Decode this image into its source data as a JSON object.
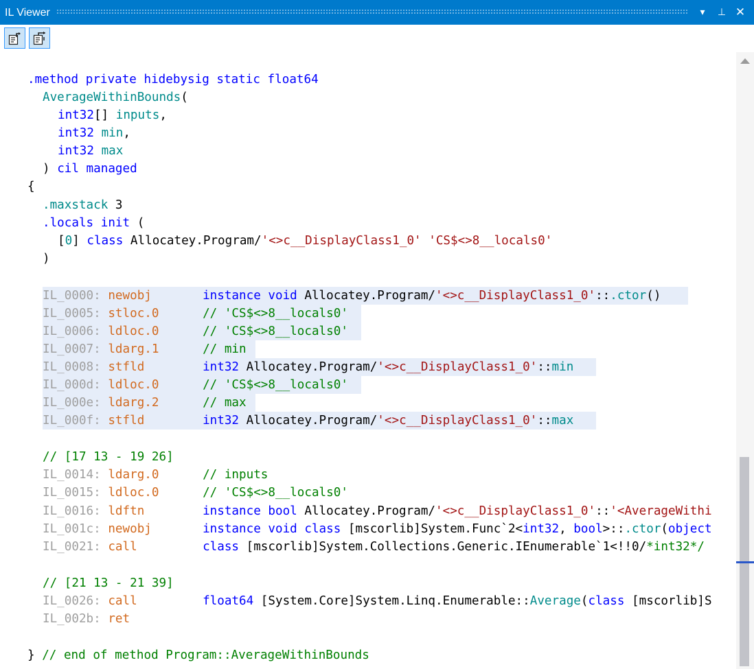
{
  "window": {
    "title": "IL Viewer",
    "dropdown_glyph": "▾",
    "pin_glyph": "⊥",
    "close_glyph": "✕"
  },
  "toolbar": {
    "buttons": [
      {
        "icon": "show-source-icon"
      },
      {
        "icon": "navigate-to-source-icon"
      }
    ]
  },
  "colors": {
    "accent": "#007acc",
    "keyword": "#0000ff",
    "label": "#a0a0a0",
    "opcode": "#d2691e",
    "string": "#a31515",
    "comment": "#008000",
    "member": "#008b8b",
    "highlight": "#e6edf9"
  },
  "code": {
    "lines": [
      [
        [
          "kw",
          ".method private hidebysig static float64"
        ]
      ],
      [
        [
          "mem",
          "AverageWithinBounds"
        ],
        [
          "tx",
          "("
        ]
      ],
      [
        [
          "kw",
          "int32"
        ],
        [
          "tx",
          "[] "
        ],
        [
          "mem",
          "inputs"
        ],
        [
          "tx",
          ","
        ]
      ],
      [
        [
          "kw",
          "int32"
        ],
        [
          "tx",
          " "
        ],
        [
          "mem",
          "min"
        ],
        [
          "tx",
          ","
        ]
      ],
      [
        [
          "kw",
          "int32"
        ],
        [
          "tx",
          " "
        ],
        [
          "mem",
          "max"
        ]
      ],
      [
        [
          "tx",
          ") "
        ],
        [
          "kw",
          "cil managed"
        ]
      ],
      [
        [
          "tx",
          "{"
        ]
      ],
      [
        [
          "mem",
          ".maxstack"
        ],
        [
          "tx",
          " 3"
        ]
      ],
      [
        [
          "kw",
          ".locals init"
        ],
        [
          "tx",
          " ("
        ]
      ],
      [
        [
          "tx",
          "["
        ],
        [
          "mem",
          "0"
        ],
        [
          "tx",
          "] "
        ],
        [
          "kw",
          "class"
        ],
        [
          "tx",
          " Allocatey.Program/"
        ],
        [
          "str",
          "'<>c__DisplayClass1_0'"
        ],
        [
          "tx",
          " "
        ],
        [
          "str",
          "'CS$<>8__locals0'"
        ]
      ],
      [
        [
          "tx",
          ")"
        ]
      ],
      [
        [
          "lbl",
          "IL_0000: "
        ],
        [
          "op",
          "newobj"
        ],
        [
          "tx",
          "       "
        ],
        [
          "kw",
          "instance void"
        ],
        [
          "tx",
          " Allocatey.Program/"
        ],
        [
          "str",
          "'<>c__DisplayClass1_0'"
        ],
        [
          "tx",
          "::"
        ],
        [
          "mem",
          ".ctor"
        ],
        [
          "tx",
          "()"
        ]
      ],
      [
        [
          "lbl",
          "IL_0005: "
        ],
        [
          "op",
          "stloc.0"
        ],
        [
          "tx",
          "      "
        ],
        [
          "cm",
          "// 'CS$<>8__locals0'"
        ]
      ],
      [
        [
          "lbl",
          "IL_0006: "
        ],
        [
          "op",
          "ldloc.0"
        ],
        [
          "tx",
          "      "
        ],
        [
          "cm",
          "// 'CS$<>8__locals0'"
        ]
      ],
      [
        [
          "lbl",
          "IL_0007: "
        ],
        [
          "op",
          "ldarg.1"
        ],
        [
          "tx",
          "      "
        ],
        [
          "cm",
          "// min"
        ]
      ],
      [
        [
          "lbl",
          "IL_0008: "
        ],
        [
          "op",
          "stfld"
        ],
        [
          "tx",
          "        "
        ],
        [
          "kw",
          "int32"
        ],
        [
          "tx",
          " Allocatey.Program/"
        ],
        [
          "str",
          "'<>c__DisplayClass1_0'"
        ],
        [
          "tx",
          "::"
        ],
        [
          "mem",
          "min"
        ]
      ],
      [
        [
          "lbl",
          "IL_000d: "
        ],
        [
          "op",
          "ldloc.0"
        ],
        [
          "tx",
          "      "
        ],
        [
          "cm",
          "// 'CS$<>8__locals0'"
        ]
      ],
      [
        [
          "lbl",
          "IL_000e: "
        ],
        [
          "op",
          "ldarg.2"
        ],
        [
          "tx",
          "      "
        ],
        [
          "cm",
          "// max"
        ]
      ],
      [
        [
          "lbl",
          "IL_000f: "
        ],
        [
          "op",
          "stfld"
        ],
        [
          "tx",
          "        "
        ],
        [
          "kw",
          "int32"
        ],
        [
          "tx",
          " Allocatey.Program/"
        ],
        [
          "str",
          "'<>c__DisplayClass1_0'"
        ],
        [
          "tx",
          "::"
        ],
        [
          "mem",
          "max"
        ]
      ],
      [
        [
          "cm",
          "// [17 13 - 19 26]"
        ]
      ],
      [
        [
          "lbl",
          "IL_0014: "
        ],
        [
          "op",
          "ldarg.0"
        ],
        [
          "tx",
          "      "
        ],
        [
          "cm",
          "// inputs"
        ]
      ],
      [
        [
          "lbl",
          "IL_0015: "
        ],
        [
          "op",
          "ldloc.0"
        ],
        [
          "tx",
          "      "
        ],
        [
          "cm",
          "// 'CS$<>8__locals0'"
        ]
      ],
      [
        [
          "lbl",
          "IL_0016: "
        ],
        [
          "op",
          "ldftn"
        ],
        [
          "tx",
          "        "
        ],
        [
          "kw",
          "instance bool"
        ],
        [
          "tx",
          " Allocatey.Program/"
        ],
        [
          "str",
          "'<>c__DisplayClass1_0'"
        ],
        [
          "tx",
          "::"
        ],
        [
          "str",
          "'<AverageWithi"
        ]
      ],
      [
        [
          "lbl",
          "IL_001c: "
        ],
        [
          "op",
          "newobj"
        ],
        [
          "tx",
          "       "
        ],
        [
          "kw",
          "instance void class"
        ],
        [
          "tx",
          " [mscorlib]System.Func`2<"
        ],
        [
          "kw",
          "int32"
        ],
        [
          "tx",
          ", "
        ],
        [
          "kw",
          "bool"
        ],
        [
          "tx",
          ">::"
        ],
        [
          "mem",
          ".ctor"
        ],
        [
          "tx",
          "("
        ],
        [
          "kw",
          "object"
        ]
      ],
      [
        [
          "lbl",
          "IL_0021: "
        ],
        [
          "op",
          "call"
        ],
        [
          "tx",
          "         "
        ],
        [
          "kw",
          "class"
        ],
        [
          "tx",
          " [mscorlib]System.Collections.Generic.IEnumerable`1<!!0/"
        ],
        [
          "cm",
          "*int32*/"
        ]
      ],
      [
        [
          "cm",
          "// [21 13 - 21 39]"
        ]
      ],
      [
        [
          "lbl",
          "IL_0026: "
        ],
        [
          "op",
          "call"
        ],
        [
          "tx",
          "         "
        ],
        [
          "kw",
          "float64"
        ],
        [
          "tx",
          " [System.Core]System.Linq.Enumerable::"
        ],
        [
          "mem",
          "Average"
        ],
        [
          "tx",
          "("
        ],
        [
          "kw",
          "class"
        ],
        [
          "tx",
          " [mscorlib]S"
        ]
      ],
      [
        [
          "lbl",
          "IL_002b: "
        ],
        [
          "op",
          "ret"
        ]
      ],
      [
        [
          "tx",
          "} "
        ],
        [
          "cm",
          "// end of method Program::AverageWithinBounds"
        ]
      ]
    ]
  }
}
